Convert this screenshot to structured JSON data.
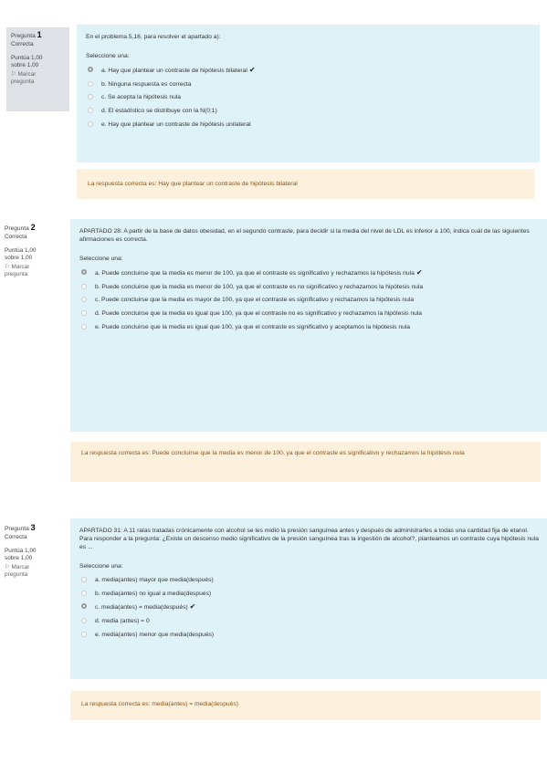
{
  "questions": [
    {
      "label": "Pregunta",
      "number": "1",
      "state": "Correcta",
      "grade_line1": "Puntúa 1,00",
      "grade_line2": "sobre 1,00",
      "flag_line1": "Marcar",
      "flag_line2": "pregunta",
      "text": "En el problema 5.16, para resolver el apartado a):",
      "prompt": "Seleccione una:",
      "answers": [
        {
          "text": "a. Hay que plantear un contraste de hipótesis bilateral",
          "selected": true,
          "correct": true
        },
        {
          "text": "b. Ninguna respuesta es correcta",
          "selected": false,
          "correct": false
        },
        {
          "text": "c. Se acepta la hipótesis nula",
          "selected": false,
          "correct": false
        },
        {
          "text": "d. El estadístico se distribuye con la N(0;1)",
          "selected": false,
          "correct": false
        },
        {
          "text": "e. Hay que plantear un contraste de hipótesis unilateral",
          "selected": false,
          "correct": false
        }
      ],
      "feedback": "La respuesta correcta es: Hay que plantear un contraste de hipótesis bilateral"
    },
    {
      "label": "Pregunta",
      "number": "2",
      "state": "Correcta",
      "grade_line1": "Puntúa 1,00",
      "grade_line2": "sobre 1,00",
      "flag_line1": "Marcar",
      "flag_line2": "pregunta",
      "text": "APARTADO 28: A partir de la base de datos obesidad, en el segundo contraste, para decidir si la media del nivel de LDL es inferior a 100, indica cuál de las siguientes afirmaciones es correcta.",
      "prompt": "Seleccione una:",
      "answers": [
        {
          "text": "a. Puede concluirse que la media es menor de 100, ya que el contraste es significativo y rechazamos la hipótesis nula",
          "selected": true,
          "correct": true
        },
        {
          "text": "b. Puede concluirse que la media es menor de 100, ya que el contraste es no significativo y rechazamos la hipótesis nula",
          "selected": false,
          "correct": false
        },
        {
          "text": "c. Puede concluirse que la media es mayor de 100, ya que el contraste es significativo y rechazamos la hipótesis nula",
          "selected": false,
          "correct": false
        },
        {
          "text": "d. Puede concluirse que la media es igual que 100, ya que el contraste no es significativo y rechazamos la hipótesis nula",
          "selected": false,
          "correct": false
        },
        {
          "text": "e. Puede concluirse que la media es igual que 100, ya que el contraste es significativo y aceptamos la hipótesis nula",
          "selected": false,
          "correct": false
        }
      ],
      "feedback": "La respuesta correcta es: Puede concluirse que la media es menor de 100, ya que el contraste es significativo y rechazamos la hipótesis nula"
    },
    {
      "label": "Pregunta",
      "number": "3",
      "state": "Correcta",
      "grade_line1": "Puntúa 1,00",
      "grade_line2": "sobre 1,00",
      "flag_line1": "Marcar",
      "flag_line2": "pregunta",
      "text": "APARTADO 31: A 11 ratas tratadas crónicamente con alcohol se les midió la presión sanguínea antes y después de administrarles a todas una cantidad fija de etanol. Para responder a la pregunta: ¿Existe un descenso medio significativo de la presión sanguínea tras la ingestión de alcohol?, planteamos un contraste cuya hipótesis nula es ...",
      "prompt": "Seleccione una:",
      "answers": [
        {
          "text": "a. media(antes) mayor que media(después)",
          "selected": false,
          "correct": false
        },
        {
          "text": "b. media(antes) no igual a media(después)",
          "selected": false,
          "correct": false
        },
        {
          "text": "c. media(antes) = media(después)",
          "selected": true,
          "correct": true
        },
        {
          "text": "d. media (antes) = 0",
          "selected": false,
          "correct": false
        },
        {
          "text": "e. media(antes) menor que media(después)",
          "selected": false,
          "correct": false
        }
      ],
      "feedback": "La respuesta correcta es: media(antes) = media(después)"
    }
  ],
  "colors": {
    "info_bg": "#dee2e6",
    "content_bg": "#def2f8",
    "feedback_bg": "#fdf1de",
    "feedback_text": "#8a5312"
  }
}
